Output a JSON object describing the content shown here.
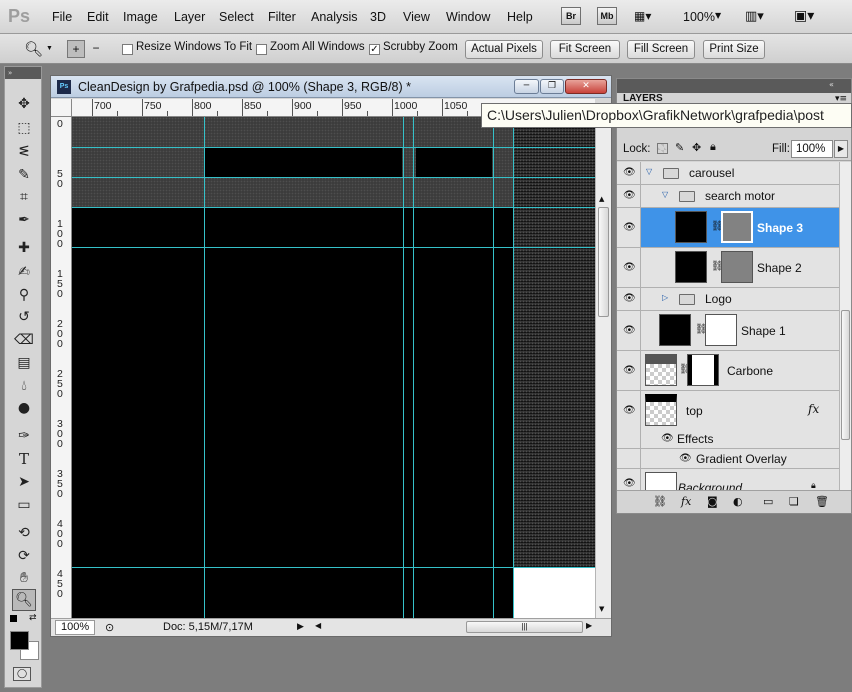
{
  "app": {
    "logo": "Ps",
    "menu": [
      "File",
      "Edit",
      "Image",
      "Layer",
      "Select",
      "Filter",
      "Analysis",
      "3D",
      "View",
      "Window",
      "Help"
    ],
    "bridge_label": "Br",
    "minibridge_label": "Mb",
    "zoom_level": "100%"
  },
  "options": {
    "resize_windows": "Resize Windows To Fit",
    "zoom_all": "Zoom All Windows",
    "scrubby_zoom": "Scrubby Zoom",
    "actual_pixels": "Actual Pixels",
    "fit_screen": "Fit Screen",
    "fill_screen": "Fill Screen",
    "print_size": "Print Size"
  },
  "document": {
    "title": "CleanDesign by Grafpedia.psd @ 100% (Shape 3, RGB/8) *",
    "ps_icon": "Ps",
    "ruler_top": [
      "700",
      "750",
      "800",
      "850",
      "900",
      "950",
      "1000",
      "1050"
    ],
    "ruler_left": [
      "0",
      "5\n0",
      "1\n0\n0",
      "1\n5\n0",
      "2\n0\n0",
      "2\n5\n0",
      "3\n0\n0",
      "3\n5\n0",
      "4\n0\n0",
      "4\n5\n0"
    ],
    "status_zoom": "100%",
    "status_doc": "Doc: 5,15M/7,17M"
  },
  "tooltip": {
    "path": "C:\\Users\\Julien\\Dropbox\\GrafikNetwork\\grafpedia\\post"
  },
  "layers_panel": {
    "tab": "LAYERS",
    "lock_label": "Lock:",
    "fill_label": "Fill:",
    "fill_value": "100%",
    "rows": {
      "carousel": "carousel",
      "search_motor": "search motor",
      "shape3": "Shape 3",
      "shape2": "Shape 2",
      "logo": "Logo",
      "shape1": "Shape 1",
      "carbone": "Carbone",
      "top": "top",
      "fx_badge": "fx",
      "effects": "Effects",
      "gradient_overlay": "Gradient Overlay",
      "background": "Background"
    }
  },
  "colors": {
    "guide": "#35c1c9",
    "selection": "#3f93e8",
    "canvas": "#000000"
  }
}
